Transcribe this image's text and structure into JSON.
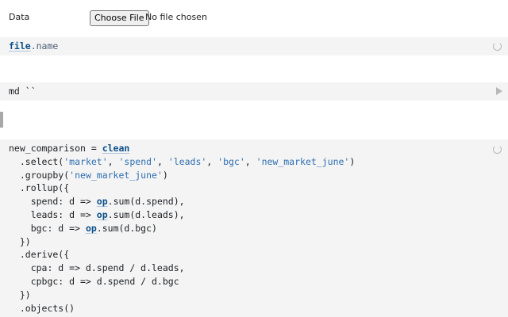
{
  "input_row": {
    "label": "Data",
    "button_label": "Choose File",
    "status": "No file chosen"
  },
  "cell1": {
    "ref": "file",
    "prop": ".name"
  },
  "cell2": {
    "code": "md ``"
  },
  "cell3": {
    "lines": [
      {
        "a": "new_comparison = ",
        "b": "clean"
      },
      {
        "a": "  .select(",
        "s1": "'market'",
        "m1": ", ",
        "s2": "'spend'",
        "m2": ", ",
        "s3": "'leads'",
        "m3": ", ",
        "s4": "'bgc'",
        "m4": ", ",
        "s5": "'new_market_june'",
        "z": ")"
      },
      {
        "a": "  .groupby(",
        "s1": "'new_market_june'",
        "z": ")"
      },
      {
        "a": "  .rollup({"
      },
      {
        "a": "    spend: d => ",
        "r": "op",
        "z": ".sum(d.spend),"
      },
      {
        "a": "    leads: d => ",
        "r": "op",
        "z": ".sum(d.leads),"
      },
      {
        "a": "    bgc: d => ",
        "r": "op",
        "z": ".sum(d.bgc)"
      },
      {
        "a": "  })"
      },
      {
        "a": "  .derive({"
      },
      {
        "a": "    cpa: d => d.spend / d.leads,"
      },
      {
        "a": "    cpbgc: d => d.spend / d.bgc"
      },
      {
        "a": "  })"
      },
      {
        "a": "  .objects()"
      }
    ]
  },
  "icons": {
    "cell1_status": "spinner-icon",
    "cell2_status": "play-icon",
    "cell3_status": "spinner-icon"
  }
}
